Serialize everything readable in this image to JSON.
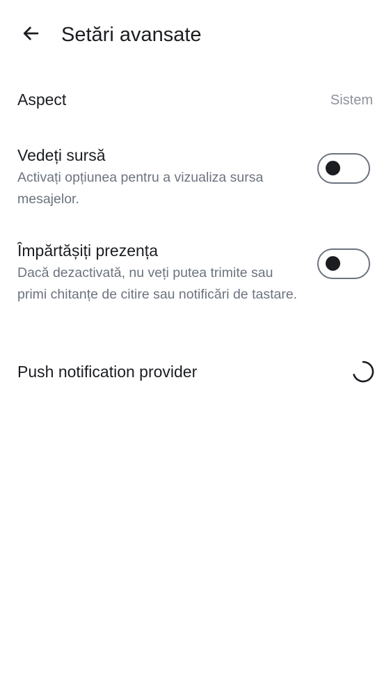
{
  "header": {
    "back_icon": "arrow-left-icon",
    "title": "Setări avansate"
  },
  "settings": {
    "appearance": {
      "label": "Aspect",
      "value": "Sistem"
    },
    "view_source": {
      "label": "Vedeți sursă",
      "description": "Activați opțiunea pentru a vizualiza sursa mesajelor.",
      "enabled": false
    },
    "share_presence": {
      "label": "Împărtășiți prezența",
      "description": "Dacă dezactivată, nu veți putea trimite sau primi chitanțe de citire sau notificări de tastare.",
      "enabled": false
    },
    "push_provider": {
      "label": "Push notification provider",
      "status_icon": "loading-spinner-icon"
    }
  },
  "colors": {
    "text_primary": "#1b1d21",
    "text_secondary": "#6c737e",
    "toggle_border": "#6c737e"
  }
}
